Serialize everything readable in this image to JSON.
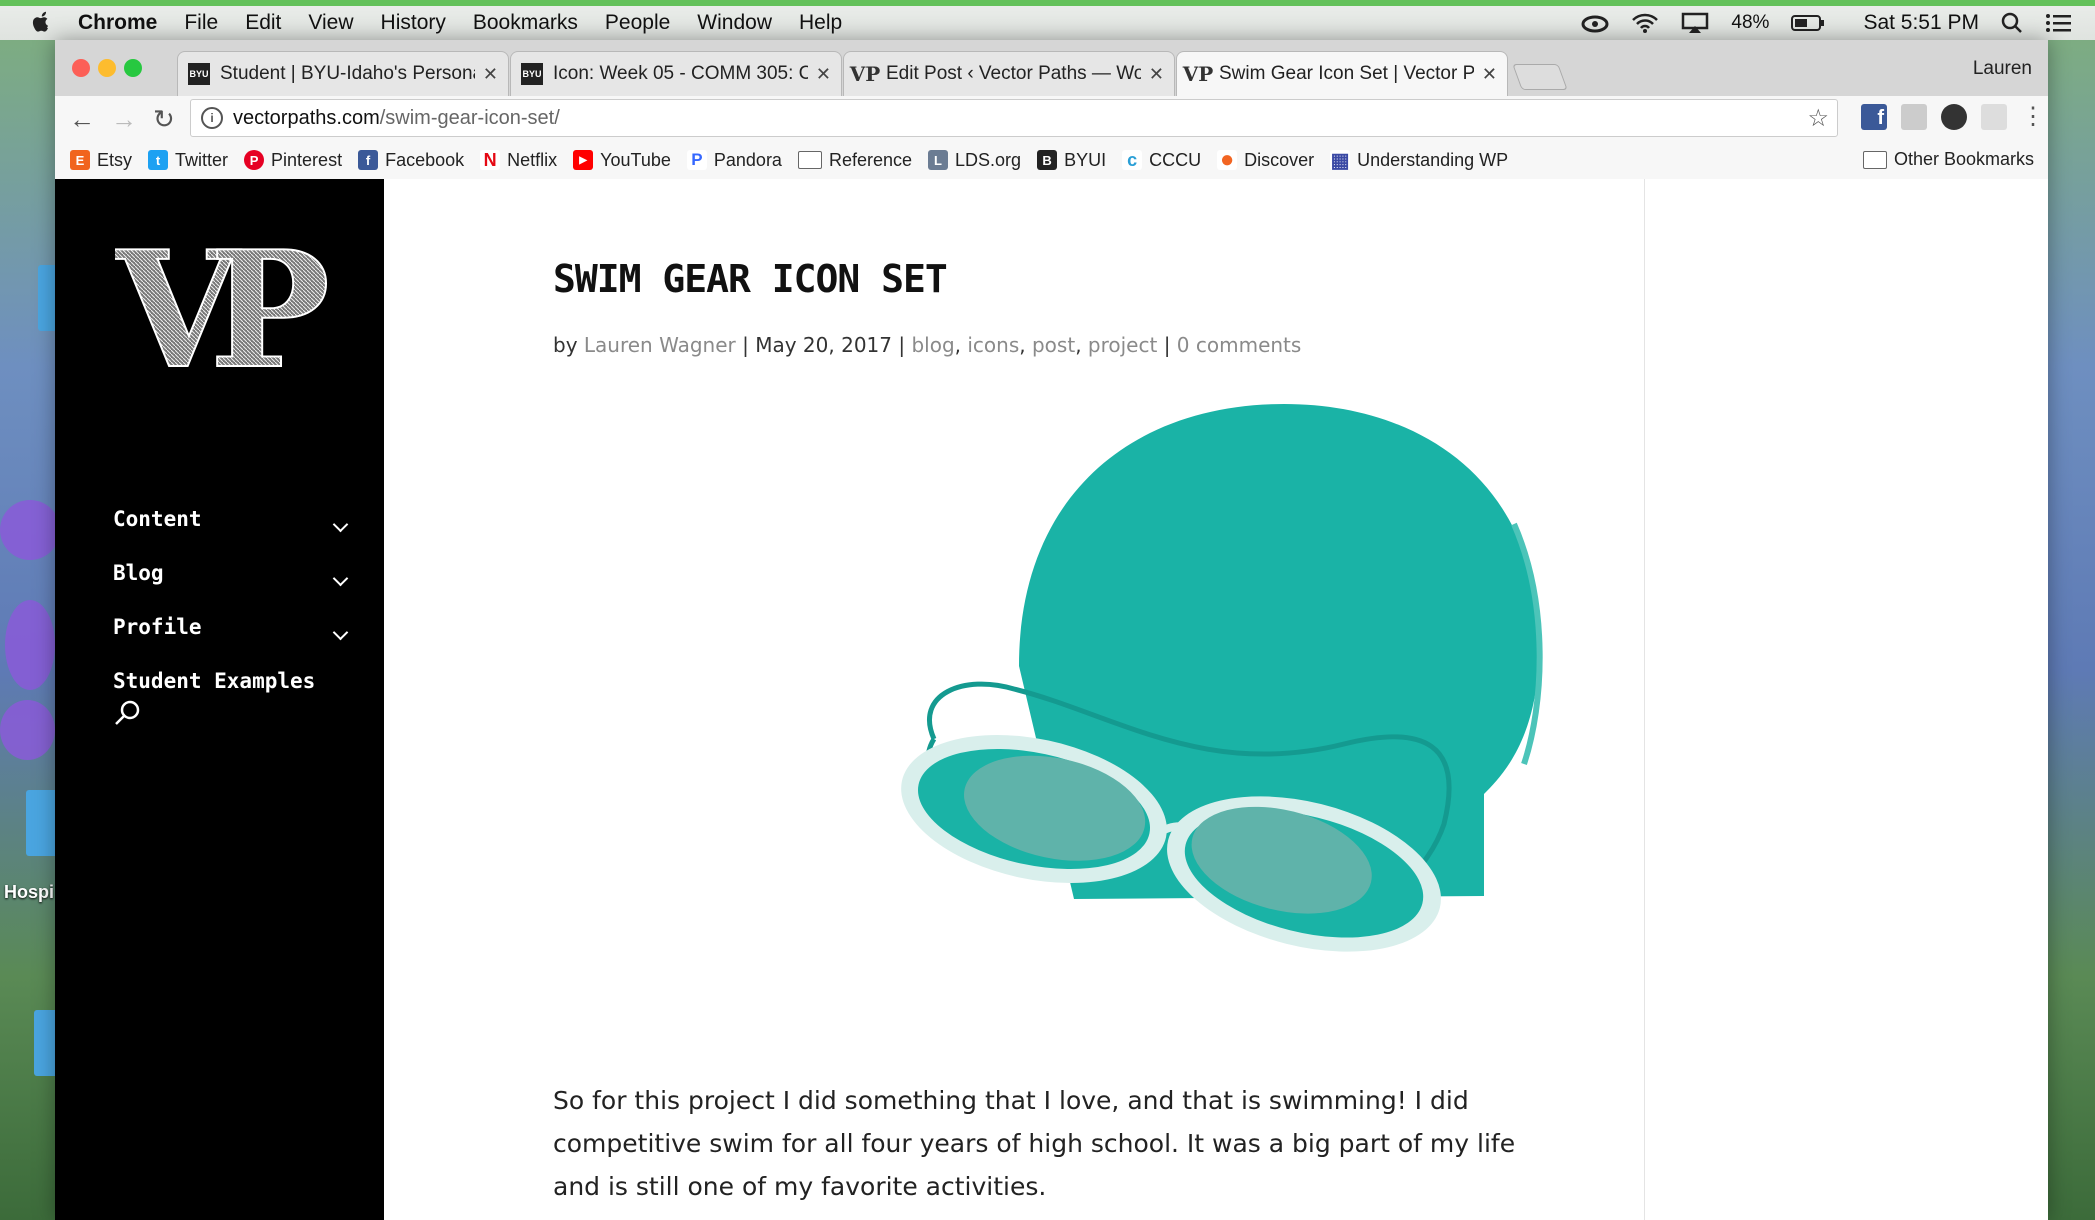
{
  "menubar": {
    "app": "Chrome",
    "items": [
      "File",
      "Edit",
      "View",
      "History",
      "Bookmarks",
      "People",
      "Window",
      "Help"
    ],
    "battery": "48%",
    "clock": "Sat 5:51 PM"
  },
  "desktop": {
    "label_hospi": "Hospi"
  },
  "tabs": [
    {
      "title": "Student | BYU-Idaho's Persona",
      "favicon": "BYU"
    },
    {
      "title": "Icon: Week 05 - COMM 305: C",
      "favicon": "BYU"
    },
    {
      "title": "Edit Post ‹ Vector Paths — Wo",
      "favicon": "VP"
    },
    {
      "title": "Swim Gear Icon Set | Vector Pa",
      "favicon": "VP"
    }
  ],
  "profile_name": "Lauren",
  "address": {
    "host": "vectorpaths.com",
    "path": "/swim-gear-icon-set/"
  },
  "bookmarks": [
    {
      "label": "Etsy",
      "color": "#f1641e",
      "glyph": "E"
    },
    {
      "label": "Twitter",
      "color": "#1da1f2",
      "glyph": "t"
    },
    {
      "label": "Pinterest",
      "color": "#e60023",
      "glyph": "P"
    },
    {
      "label": "Facebook",
      "color": "#3b5998",
      "glyph": "f"
    },
    {
      "label": "Netflix",
      "color": "#e50914",
      "glyph": "N"
    },
    {
      "label": "YouTube",
      "color": "#ff0000",
      "glyph": "▶"
    },
    {
      "label": "Pandora",
      "color": "#3668ff",
      "glyph": "P"
    },
    {
      "label": "Reference",
      "color": "folder",
      "glyph": ""
    },
    {
      "label": "LDS.org",
      "color": "#6b7c93",
      "glyph": "L"
    },
    {
      "label": "BYUI",
      "color": "#222222",
      "glyph": "B"
    },
    {
      "label": "CCCU",
      "color": "#2a9fd6",
      "glyph": "c"
    },
    {
      "label": "Discover",
      "color": "#f26522",
      "glyph": "●"
    },
    {
      "label": "Understanding WP",
      "color": "#3b4aa5",
      "glyph": "▦"
    }
  ],
  "other_bookmarks": "Other Bookmarks",
  "sidebar": {
    "logo_text": "VP",
    "nav": [
      {
        "label": "Content",
        "has_dropdown": true
      },
      {
        "label": "Blog",
        "has_dropdown": true
      },
      {
        "label": "Profile",
        "has_dropdown": true
      },
      {
        "label": "Student Examples",
        "has_dropdown": false
      }
    ]
  },
  "post": {
    "title": "SWIM GEAR ICON SET",
    "by": "by",
    "author": "Lauren Wagner",
    "date": "May 20, 2017",
    "categories": [
      "blog",
      "icons",
      "post",
      "project"
    ],
    "comments": "0 comments",
    "body": "So for this project I did something that I love, and that is swimming! I did competitive swim for all four years of high school. It was a big part of my life and is still one of my favorite activities."
  },
  "colors": {
    "cap": "#1ab3a6",
    "lens": "#5fb3aa",
    "frame": "#d9efec",
    "sidebar": "#000000"
  }
}
